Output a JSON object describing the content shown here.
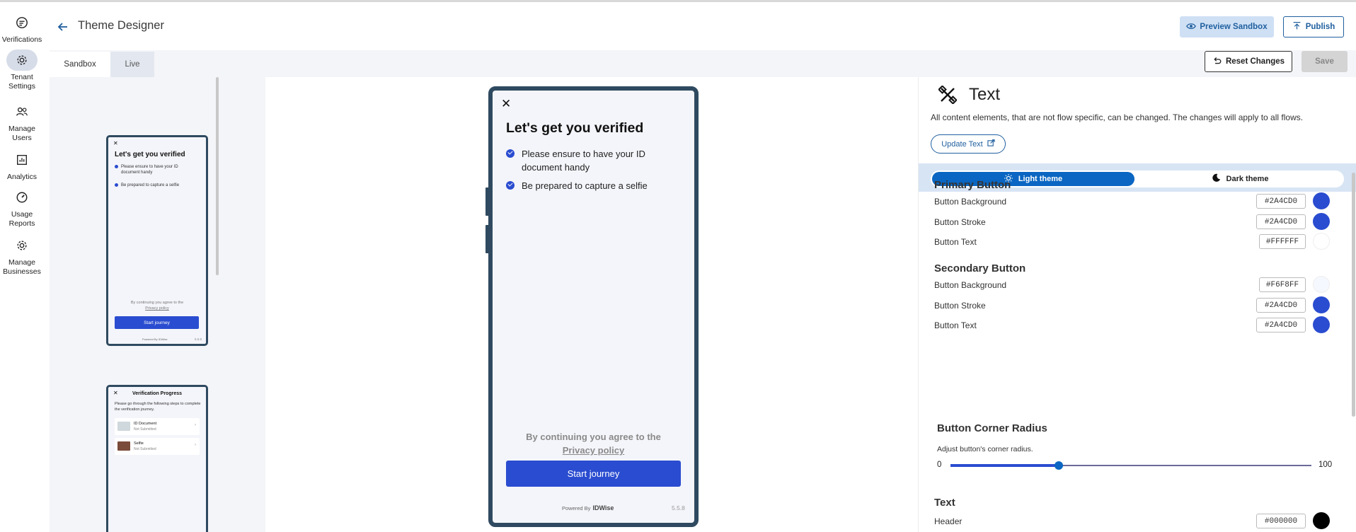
{
  "nav": {
    "items": [
      {
        "label": "Verifications",
        "icon": "verifications-icon"
      },
      {
        "label": "Tenant\nSettings",
        "icon": "gear-icon"
      },
      {
        "label": "Manage\nUsers",
        "icon": "users-icon"
      },
      {
        "label": "Analytics",
        "icon": "analytics-icon"
      },
      {
        "label": "Usage\nReports",
        "icon": "gauge-icon"
      },
      {
        "label": "Manage\nBusinesses",
        "icon": "gear-icon"
      }
    ],
    "active_index": 1
  },
  "header": {
    "title": "Theme Designer",
    "preview_label": "Preview Sandbox",
    "publish_label": "Publish"
  },
  "tabs": {
    "sandbox": "Sandbox",
    "live": "Live",
    "reset_label": "Reset Changes",
    "save_label": "Save"
  },
  "thumb1": {
    "close": "✕",
    "heading": "Let's get you verified",
    "item1": "Please ensure to have your ID document handy",
    "item2": "Be prepared to capture a selfie",
    "agree": "By continuing you agree to the",
    "privacy": "Privacy policy",
    "start": "Start journey",
    "powered": "Powered By",
    "brand": "IDWise",
    "version": "5.5.8"
  },
  "thumb2": {
    "close": "✕",
    "heading": "Verification Progress",
    "desc": "Please go through the following steps to complete the verification journey.",
    "card1_title": "ID Document",
    "card1_status": "Not Submitted",
    "card2_title": "Selfie",
    "card2_status": "Not Submitted"
  },
  "preview": {
    "close": "✕",
    "heading": "Let's get you verified",
    "item1": "Please ensure to have your ID document handy",
    "item2": "Be prepared to capture a selfie",
    "agree": "By continuing you agree to the",
    "privacy": "Privacy policy",
    "start": "Start journey",
    "powered": "Powered By",
    "brand": "IDWise",
    "version": "5.5.8"
  },
  "panel": {
    "title": "Text",
    "description": "All content elements, that are not flow specific, can be changed. The changes will apply to all flows.",
    "update_label": "Update Text",
    "light_theme": "Light theme",
    "dark_theme": "Dark theme",
    "primary": {
      "title": "Primary Button",
      "background_label": "Button Background",
      "background": "#2A4CD0",
      "stroke_label": "Button Stroke",
      "stroke": "#2A4CD0",
      "text_label": "Button Text",
      "text": "#FFFFFF"
    },
    "secondary": {
      "title": "Secondary Button",
      "background_label": "Button Background",
      "background": "#F6F8FF",
      "stroke_label": "Button Stroke",
      "stroke": "#2A4CD0",
      "text_label": "Button Text",
      "text": "#2A4CD0"
    },
    "radius": {
      "title": "Button Corner Radius",
      "description": "Adjust button's corner radius.",
      "min": "0",
      "max": "100",
      "value": 30
    },
    "text_section": {
      "title": "Text",
      "header_label": "Header",
      "header": "#000000"
    }
  },
  "colors": {
    "brand": "#2A4CD0",
    "accent": "#0A66C2",
    "frame": "#2F4A60"
  }
}
